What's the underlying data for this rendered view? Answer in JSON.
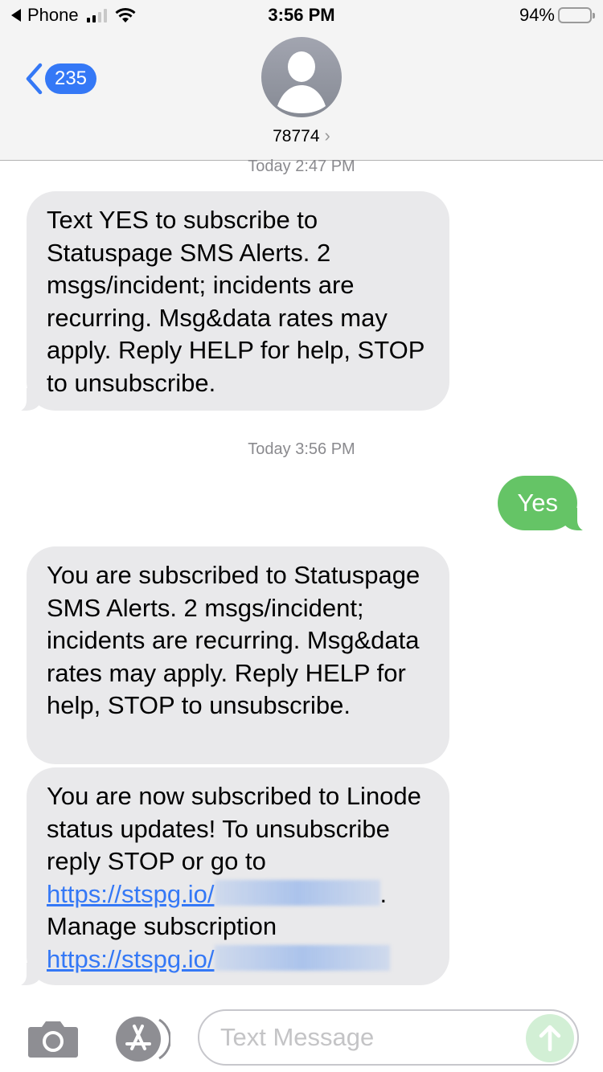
{
  "status_bar": {
    "back_app": "Phone",
    "time": "3:56 PM",
    "battery_percent": "94%",
    "battery_level": 0.94,
    "signal_bars_on": 2,
    "signal_bars_total": 4
  },
  "header": {
    "back_badge": "235",
    "contact_name": "78774",
    "contact_chevron": "›"
  },
  "conversation": {
    "timestamps": [
      "Today 2:47 PM",
      "Today 3:56 PM"
    ],
    "messages": [
      {
        "direction": "incoming",
        "text": "Text YES to subscribe to Statuspage SMS Alerts. 2 msgs/incident; incidents are recurring. Msg&data rates may apply. Reply HELP for help, STOP to unsubscribe."
      },
      {
        "direction": "outgoing",
        "text": "Yes"
      },
      {
        "direction": "incoming",
        "text": "You are subscribed to Statuspage SMS Alerts. 2 msgs/incident; incidents are recurring. Msg&data rates may apply. Reply HELP for help, STOP to unsubscribe."
      },
      {
        "direction": "incoming",
        "part1": "You are now subscribed to Linode status updates! To unsubscribe reply STOP or go to ",
        "link1": "https://stspg.io/",
        "part2": ". Manage subscription ",
        "link2": "https://stspg.io/"
      }
    ]
  },
  "input_bar": {
    "placeholder": "Text Message",
    "value": ""
  },
  "colors": {
    "accent_blue": "#3478f6",
    "sent_green": "#65c466",
    "received_gray": "#e9e9eb"
  }
}
